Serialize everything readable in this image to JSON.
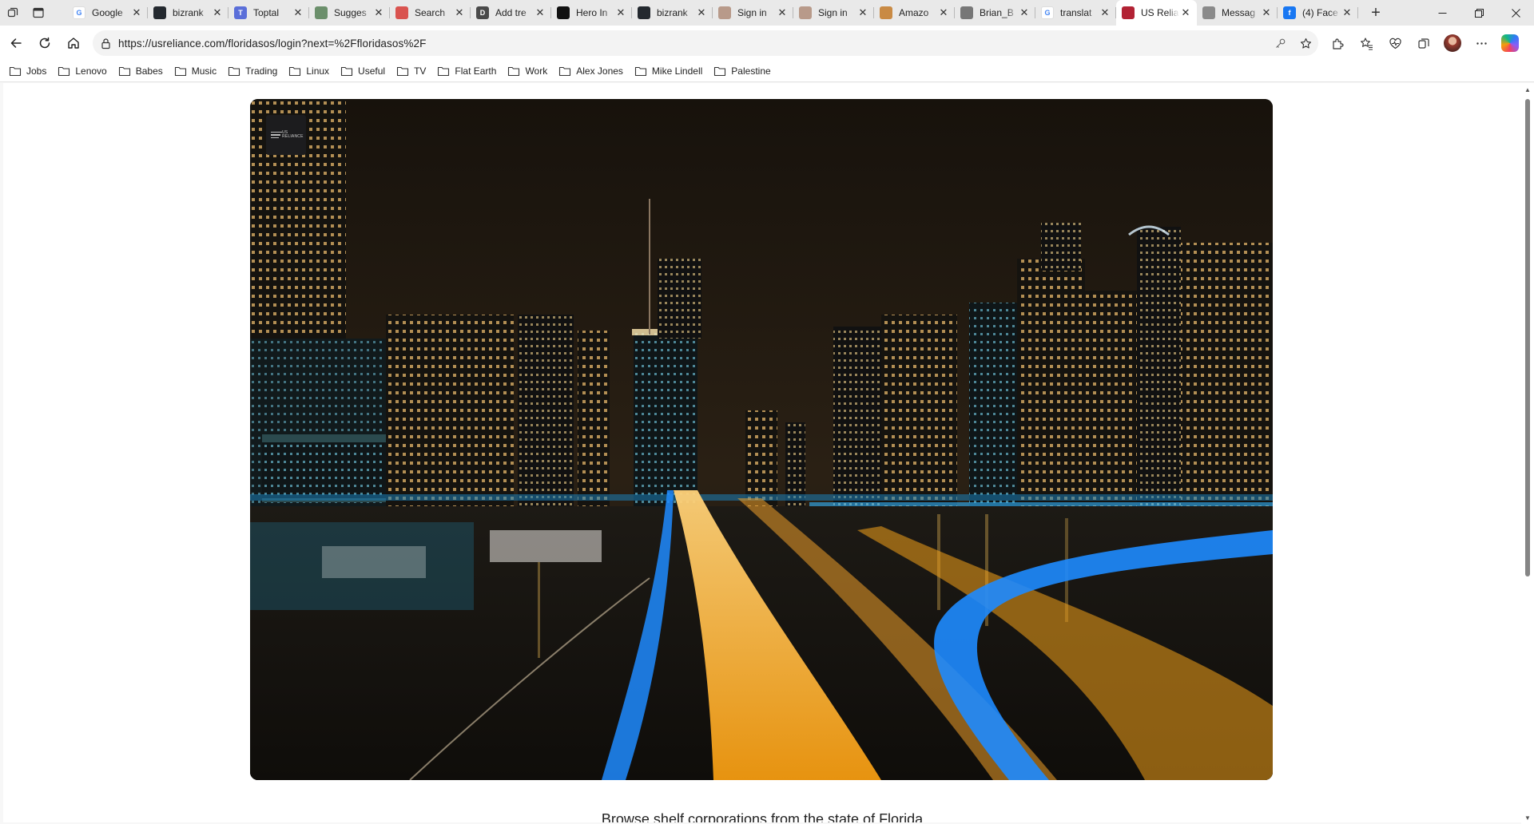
{
  "browser": {
    "tabs": [
      {
        "label": "Google",
        "fav_color": "#ffffff",
        "fav_glyph": "G"
      },
      {
        "label": "bizrank",
        "fav_color": "#24292f",
        "fav_glyph": ""
      },
      {
        "label": "Toptal",
        "fav_color": "#5b6fd9",
        "fav_glyph": "T"
      },
      {
        "label": "Sugges",
        "fav_color": "#6b8f6b",
        "fav_glyph": ""
      },
      {
        "label": "Search",
        "fav_color": "#d9534f",
        "fav_glyph": ""
      },
      {
        "label": "Add tre",
        "fav_color": "#4a4a4a",
        "fav_glyph": "D"
      },
      {
        "label": "Hero In",
        "fav_color": "#111111",
        "fav_glyph": ""
      },
      {
        "label": "bizrank",
        "fav_color": "#24292f",
        "fav_glyph": ""
      },
      {
        "label": "Sign in",
        "fav_color": "#b89a8a",
        "fav_glyph": ""
      },
      {
        "label": "Sign in",
        "fav_color": "#b89a8a",
        "fav_glyph": ""
      },
      {
        "label": "Amazo",
        "fav_color": "#c98a44",
        "fav_glyph": ""
      },
      {
        "label": "Brian_B",
        "fav_color": "#777777",
        "fav_glyph": ""
      },
      {
        "label": "translat",
        "fav_color": "#ffffff",
        "fav_glyph": "G"
      },
      {
        "label": "US Relia",
        "fav_color": "#b22234",
        "fav_glyph": ""
      },
      {
        "label": "Messag",
        "fav_color": "#8a8a8a",
        "fav_glyph": ""
      },
      {
        "label": "(4) Face",
        "fav_color": "#1877f2",
        "fav_glyph": "f"
      }
    ],
    "active_tab_index": 13,
    "url": "https://usreliance.com/floridasos/login?next=%2Ffloridasos%2F"
  },
  "bookmarks": [
    "Jobs",
    "Lenovo",
    "Babes",
    "Music",
    "Trading",
    "Linux",
    "Useful",
    "TV",
    "Flat Earth",
    "Work",
    "Alex Jones",
    "Mike Lindell",
    "Palestine"
  ],
  "page": {
    "logo_text": "US RELIANCE",
    "caption": "Browse shelf corporations from the state of Florida"
  },
  "colors": {
    "accent_orange": "#f4a21a",
    "accent_blue": "#1e8bff",
    "night_sky": "#1a140d"
  }
}
